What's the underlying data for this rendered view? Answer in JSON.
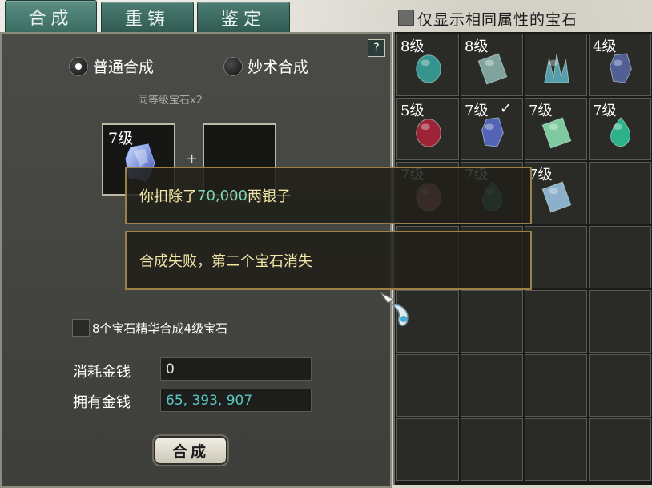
{
  "tabs": [
    {
      "label": "合成",
      "active": true
    },
    {
      "label": "重铸",
      "active": false
    },
    {
      "label": "鉴定",
      "active": false
    }
  ],
  "filter": {
    "label": "仅显示相同属性的宝石",
    "checked": false
  },
  "help_label": "?",
  "mode": {
    "normal": {
      "label": "普通合成",
      "selected": true
    },
    "magic": {
      "label": "妙术合成",
      "selected": false
    }
  },
  "hint": "同等级宝石x2",
  "slots": [
    {
      "level": "7级",
      "gem": "blue-crystal-icon"
    },
    {
      "level": "",
      "gem": ""
    }
  ],
  "plus": "+",
  "essence_option": {
    "label": "8个宝石精华合成4级宝石",
    "checked": false
  },
  "cost": {
    "label": "消耗金钱",
    "value": "0"
  },
  "owned": {
    "label": "拥有金钱",
    "value": "65, 393, 907"
  },
  "combine_button": "合成",
  "inventory": [
    {
      "level": "8级",
      "gem": "teal-oval-gem-icon",
      "color": "#3aa6a0",
      "checked": false
    },
    {
      "level": "8级",
      "gem": "pale-block-gem-icon",
      "color": "#8fb8b4",
      "checked": false
    },
    {
      "level": "",
      "gem": "teal-crystal-cluster-icon",
      "color": "#5fb3c3",
      "checked": false
    },
    {
      "level": "4级",
      "gem": "blue-small-gem-icon",
      "color": "#5968a8",
      "checked": false
    },
    {
      "level": "5级",
      "gem": "red-oval-gem-icon",
      "color": "#b3223a",
      "checked": false
    },
    {
      "level": "7级",
      "gem": "blue-crystal-icon",
      "color": "#5a6fd1",
      "checked": true,
      "check": "✓"
    },
    {
      "level": "7级",
      "gem": "green-block-gem-icon",
      "color": "#8ee6b5",
      "checked": false
    },
    {
      "level": "7级",
      "gem": "green-drop-gem-icon",
      "color": "#2ec99a",
      "checked": false
    },
    {
      "level": "7级",
      "gem": "pink-round-gem-icon",
      "color": "#d8898f",
      "checked": false
    },
    {
      "level": "7级",
      "gem": "green-drop-gem-icon",
      "color": "#2ea587",
      "checked": false
    },
    {
      "level": "7级",
      "gem": "ice-block-gem-icon",
      "color": "#9ec8e8",
      "checked": false
    }
  ],
  "messages": {
    "deduct_prefix": "你扣除了",
    "deduct_amount": "70,000",
    "deduct_suffix": "两银子",
    "fail": "合成失败，第二个宝石消失"
  }
}
